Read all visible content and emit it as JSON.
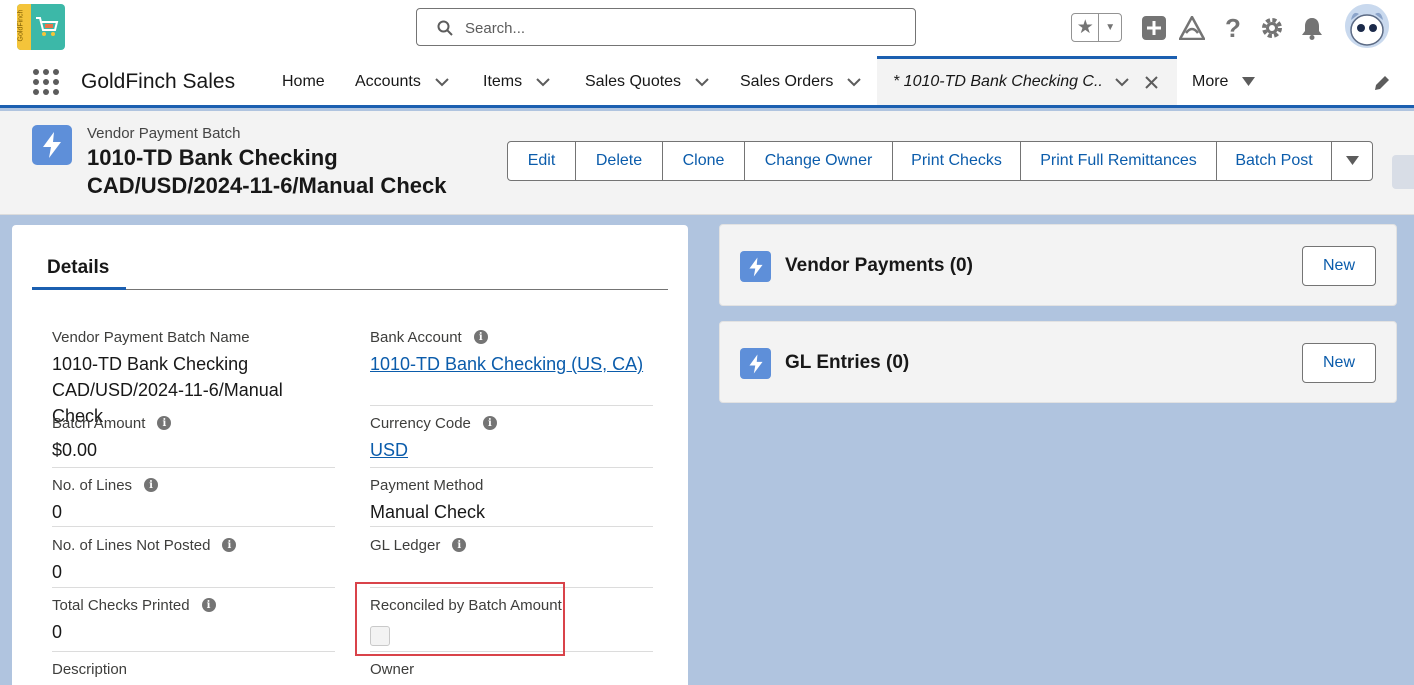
{
  "header": {
    "logo_text": "GoldFinch",
    "search_placeholder": "Search..."
  },
  "nav": {
    "app_name": "GoldFinch Sales",
    "items": [
      {
        "label": "Home",
        "has_menu": false
      },
      {
        "label": "Accounts",
        "has_menu": true
      },
      {
        "label": "Items",
        "has_menu": true
      },
      {
        "label": "Sales Quotes",
        "has_menu": true
      },
      {
        "label": "Sales Orders",
        "has_menu": true
      }
    ],
    "active_tab": "* 1010-TD Bank Checking C...",
    "more_label": "More"
  },
  "record": {
    "object_type": "Vendor Payment Batch",
    "title_line1": "1010-TD Bank Checking",
    "title_line2": "CAD/USD/2024-11-6/Manual Check",
    "actions": [
      "Edit",
      "Delete",
      "Clone",
      "Change Owner",
      "Print Checks",
      "Print Full Remittances",
      "Batch Post"
    ]
  },
  "details": {
    "tab_label": "Details",
    "fields": {
      "batch_name": {
        "label": "Vendor Payment Batch Name",
        "value_line1": "1010-TD Bank Checking",
        "value_line2": "CAD/USD/2024-11-6/Manual Check"
      },
      "bank_account": {
        "label": "Bank Account",
        "value": "1010-TD Bank Checking (US, CA)"
      },
      "batch_amount": {
        "label": "Batch Amount",
        "value": "$0.00"
      },
      "currency_code": {
        "label": "Currency Code",
        "value": "USD"
      },
      "no_of_lines": {
        "label": "No. of Lines",
        "value": "0"
      },
      "payment_method": {
        "label": "Payment Method",
        "value": "Manual Check"
      },
      "lines_not_posted": {
        "label": "No. of Lines Not Posted",
        "value": "0"
      },
      "gl_ledger": {
        "label": "GL Ledger",
        "value": ""
      },
      "checks_printed": {
        "label": "Total Checks Printed",
        "value": "0"
      },
      "reconciled": {
        "label": "Reconciled by Batch Amount",
        "checked": false
      },
      "description": {
        "label": "Description"
      },
      "owner": {
        "label": "Owner"
      }
    }
  },
  "related": [
    {
      "title": "Vendor Payments (0)",
      "button": "New"
    },
    {
      "title": "GL Entries (0)",
      "button": "New"
    }
  ],
  "colors": {
    "brand_blue": "#1b5fb0",
    "link_blue": "#0b5cab",
    "record_icon": "#5e8fd9",
    "highlight_red": "#d9434a"
  }
}
